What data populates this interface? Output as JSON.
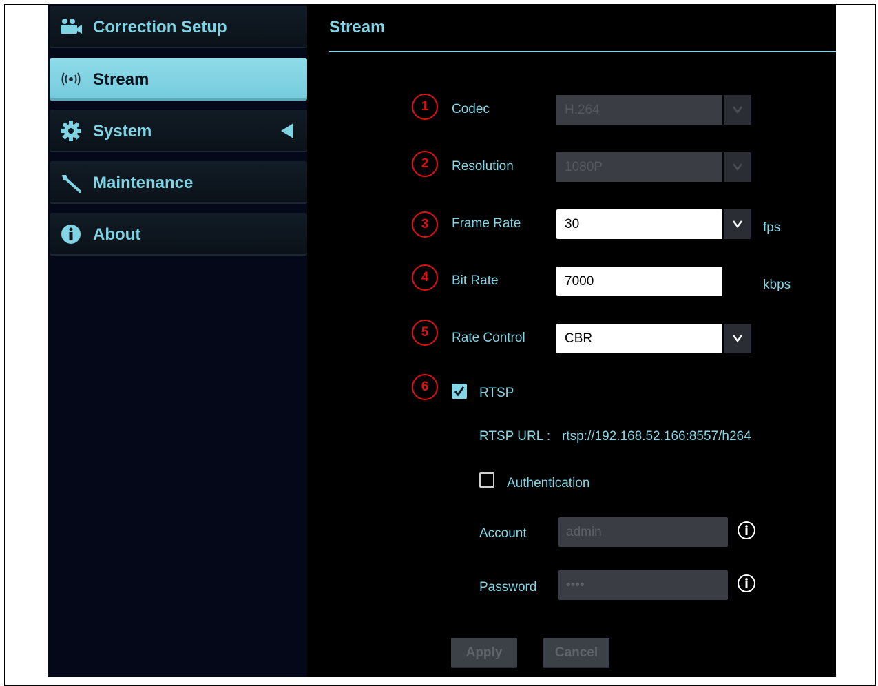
{
  "sidebar": {
    "items": [
      {
        "label": "Correction Setup",
        "icon": "video-camera-icon"
      },
      {
        "label": "Stream",
        "icon": "broadcast-icon",
        "active": true
      },
      {
        "label": "System",
        "icon": "gear-icon"
      },
      {
        "label": "Maintenance",
        "icon": "wrench-icon"
      },
      {
        "label": "About",
        "icon": "info-icon"
      }
    ]
  },
  "main": {
    "title": "Stream",
    "fields": {
      "codec": {
        "num": "1",
        "label": "Codec",
        "value": "H.264"
      },
      "resolution": {
        "num": "2",
        "label": "Resolution",
        "value": "1080P"
      },
      "frame_rate": {
        "num": "3",
        "label": "Frame Rate",
        "value": "30",
        "unit": "fps"
      },
      "bit_rate": {
        "num": "4",
        "label": "Bit Rate",
        "value": "7000",
        "unit": "kbps"
      },
      "rate_control": {
        "num": "5",
        "label": "Rate Control",
        "value": "CBR"
      },
      "rtsp": {
        "num": "6",
        "label": "RTSP",
        "checked": true
      },
      "rtsp_url": {
        "label": "RTSP URL :",
        "value": "rtsp://192.168.52.166:8557/h264"
      },
      "authentication": {
        "label": "Authentication",
        "checked": false
      },
      "account": {
        "label": "Account",
        "placeholder": "admin"
      },
      "password": {
        "label": "Password",
        "value": "••••"
      }
    },
    "buttons": {
      "apply": "Apply",
      "cancel": "Cancel"
    }
  },
  "colors": {
    "accent": "#84d5e5",
    "marker_red": "#e01010",
    "background": "#000000"
  }
}
